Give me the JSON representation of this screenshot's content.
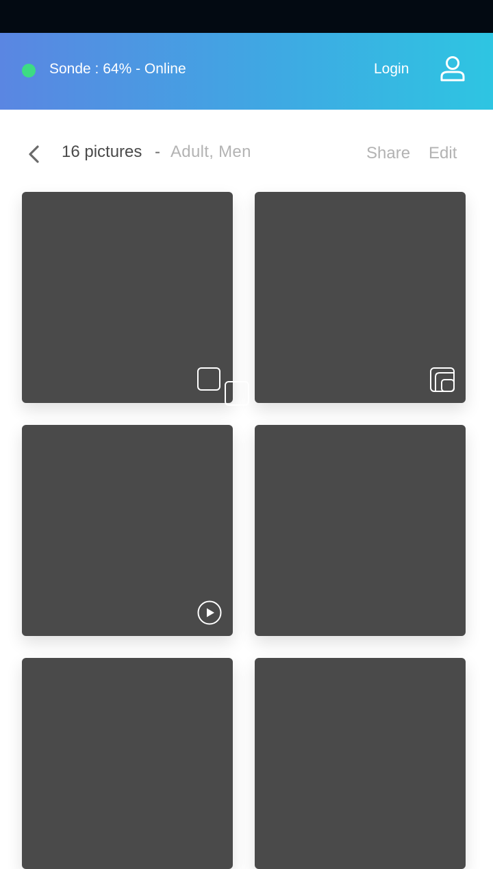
{
  "status": {
    "text": "Sonde : 64% - Online",
    "dot_color": "#3ddc84"
  },
  "header": {
    "login_label": "Login",
    "user_icon": "user-icon"
  },
  "subheader": {
    "count_label": "16 pictures",
    "separator": "-",
    "tags": "Adult, Men",
    "share_label": "Share",
    "edit_label": "Edit",
    "back_icon": "chevron-left-icon"
  },
  "tiles": [
    {
      "overlay": "select-box-icon"
    },
    {
      "overlay": "gallery-icon"
    },
    {
      "overlay": "play-icon"
    },
    {
      "overlay": "none"
    },
    {
      "overlay": "none"
    },
    {
      "overlay": "none"
    }
  ],
  "colors": {
    "gradient_start": "#5a86e2",
    "gradient_end": "#2ec5e2",
    "tile": "#4a4a4a",
    "muted_text": "#b3b3b3"
  }
}
